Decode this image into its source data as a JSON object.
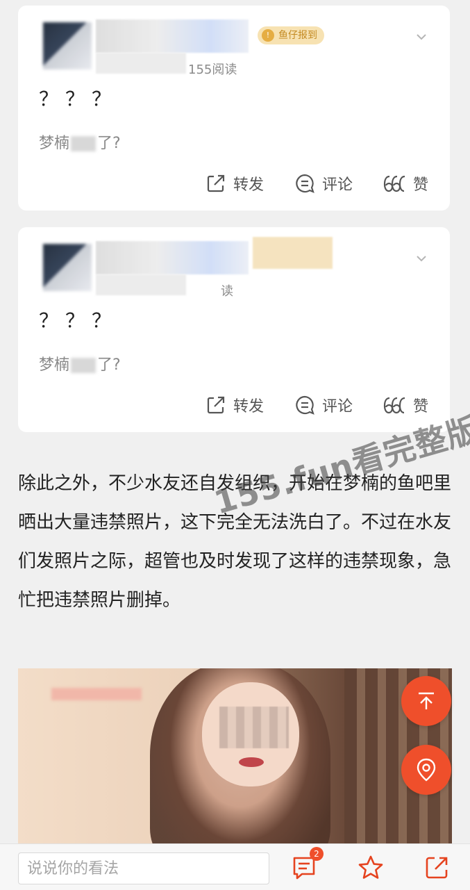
{
  "posts": [
    {
      "badge": "鱼仔报到",
      "read_count": "155阅读",
      "title": "？？？",
      "subtitle_prefix": "梦楠",
      "subtitle_suffix": "了?",
      "actions": {
        "share": "转发",
        "comment": "评论",
        "like": "赞"
      }
    },
    {
      "read_count": "读",
      "title": "？？？",
      "subtitle_prefix": "梦楠",
      "subtitle_suffix": "了?",
      "actions": {
        "share": "转发",
        "comment": "评论",
        "like": "赞"
      }
    }
  ],
  "article": {
    "paragraph": "除此之外，不少水友还自发组织，开始在梦楠的鱼吧里晒出大量违禁照片，这下完全无法洗白了。不过在水友们发照片之际，超管也及时发现了这样的违禁现象，急忙把违禁照片删掉。"
  },
  "watermark": "155.fun看完整版",
  "bottom_bar": {
    "comment_placeholder": "说说你的看法",
    "comment_count": "2"
  },
  "colors": {
    "accent": "#ef4f2b",
    "badge_bg": "#f7e2b2",
    "badge_text": "#c48a22"
  },
  "icons": {
    "scroll_top": "arrow-up-icon",
    "location": "map-pin-icon",
    "comments": "comment-list-icon",
    "favorite": "star-icon",
    "share": "share-icon"
  }
}
